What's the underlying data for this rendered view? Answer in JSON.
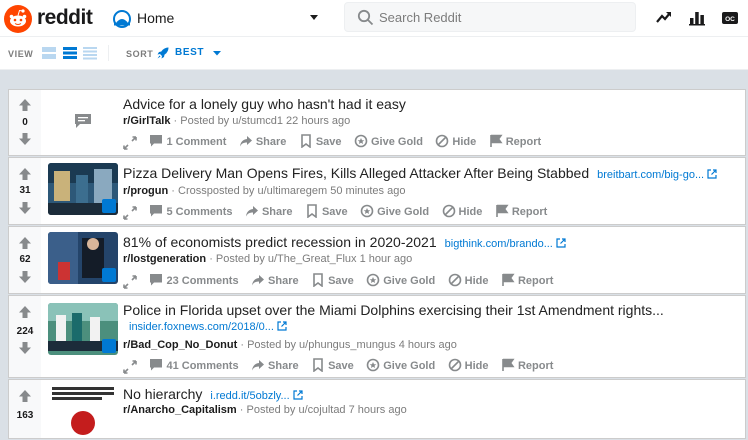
{
  "header": {
    "wordmark": "reddit",
    "home_label": "Home",
    "search_placeholder": "Search Reddit",
    "brand_color": "#ff4500",
    "accent_color": "#0079d3"
  },
  "subbar": {
    "view_label": "VIEW",
    "sort_label": "SORT",
    "sort_value": "BEST"
  },
  "posts": [
    {
      "score": "0",
      "title": "Advice for a lonely guy who hasn't had it easy",
      "domain": "",
      "subreddit": "r/GirlTalk",
      "byline": "· Posted by u/stumcd1 22 hours ago",
      "comments": "1 Comment",
      "share": "Share",
      "save": "Save",
      "give_gold": "Give Gold",
      "hide": "Hide",
      "report": "Report"
    },
    {
      "score": "31",
      "title": "Pizza Delivery Man Opens Fires, Kills Alleged Attacker After Being Stabbed",
      "domain": "breitbart.com/big-go...",
      "subreddit": "r/progun",
      "byline": "· Crossposted by u/ultimaregem 50 minutes ago",
      "comments": "5 Comments",
      "share": "Share",
      "save": "Save",
      "give_gold": "Give Gold",
      "hide": "Hide",
      "report": "Report"
    },
    {
      "score": "62",
      "title": "81% of economists predict recession in 2020-2021",
      "domain": "bigthink.com/brando...",
      "subreddit": "r/lostgeneration",
      "byline": "· Posted by u/The_Great_Flux 1 hour ago",
      "comments": "23 Comments",
      "share": "Share",
      "save": "Save",
      "give_gold": "Give Gold",
      "hide": "Hide",
      "report": "Report"
    },
    {
      "score": "224",
      "title": "Police in Florida upset over the Miami Dolphins exercising their 1st Amendment rights...",
      "domain": "insider.foxnews.com/2018/0...",
      "subreddit": "r/Bad_Cop_No_Donut",
      "byline": "· Posted by u/phungus_mungus 4 hours ago",
      "comments": "41 Comments",
      "share": "Share",
      "save": "Save",
      "give_gold": "Give Gold",
      "hide": "Hide",
      "report": "Report"
    },
    {
      "score": "163",
      "title": "No hierarchy",
      "domain": "i.redd.it/5obzly...",
      "subreddit": "r/Anarcho_Capitalism",
      "byline": "· Posted by u/cojultad 7 hours ago"
    }
  ]
}
